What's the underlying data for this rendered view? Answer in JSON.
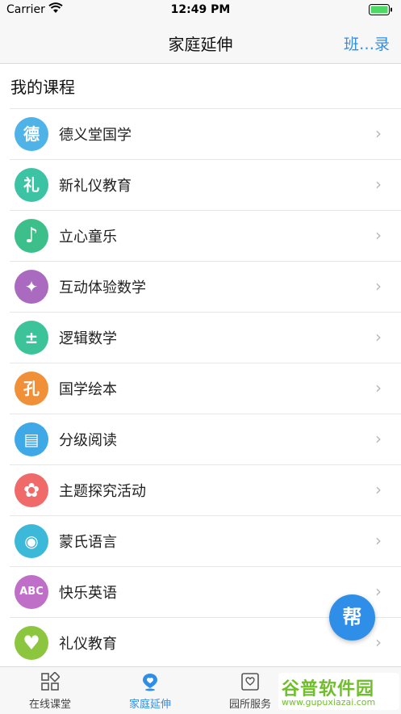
{
  "status": {
    "carrier": "Carrier",
    "time": "12:49 PM"
  },
  "nav": {
    "title": "家庭延伸",
    "right": "班…录"
  },
  "section": {
    "title": "我的课程"
  },
  "courses": [
    {
      "label": "德义堂国学",
      "icon": "de-calligraphy-icon",
      "glyph": "德",
      "color": "#4fb3e8"
    },
    {
      "label": "新礼仪教育",
      "icon": "li-calligraphy-icon",
      "glyph": "礼",
      "color": "#3cc3a3"
    },
    {
      "label": "立心童乐",
      "icon": "music-note-icon",
      "glyph": "♪",
      "color": "#3cbf8a"
    },
    {
      "label": "互动体验数学",
      "icon": "math-figure-icon",
      "glyph": "✦",
      "color": "#a96ac0"
    },
    {
      "label": "逻辑数学",
      "icon": "arithmetic-icon",
      "glyph": "±",
      "color": "#3cc39a"
    },
    {
      "label": "国学绘本",
      "icon": "picture-book-icon",
      "glyph": "孔",
      "color": "#f0913a"
    },
    {
      "label": "分级阅读",
      "icon": "open-book-icon",
      "glyph": "▤",
      "color": "#3fa8e6"
    },
    {
      "label": "主题探究活动",
      "icon": "flower-icon",
      "glyph": "✿",
      "color": "#f06a6a"
    },
    {
      "label": "蒙氏语言",
      "icon": "speech-mouth-icon",
      "glyph": "◉",
      "color": "#3cb8d8"
    },
    {
      "label": "快乐英语",
      "icon": "abc-icon",
      "glyph": "ABC",
      "color": "#c06fc9"
    },
    {
      "label": "礼仪教育",
      "icon": "handshake-heart-icon",
      "glyph": "♥",
      "color": "#8cc63f"
    }
  ],
  "help": {
    "label": "帮"
  },
  "tabs": [
    {
      "label": "在线课堂",
      "icon": "grid-icon",
      "active": false
    },
    {
      "label": "家庭延伸",
      "icon": "heart-location-icon",
      "active": true
    },
    {
      "label": "园所服务",
      "icon": "heart-bookmark-icon",
      "active": false
    },
    {
      "label": "",
      "icon": "hidden-tab-icon",
      "active": false
    }
  ],
  "watermark": {
    "main": "谷普软件园",
    "sub": "www.gupuxiazai.com"
  },
  "colors": {
    "accent": "#2f8ee8",
    "chevron": "#b8b8b8"
  }
}
